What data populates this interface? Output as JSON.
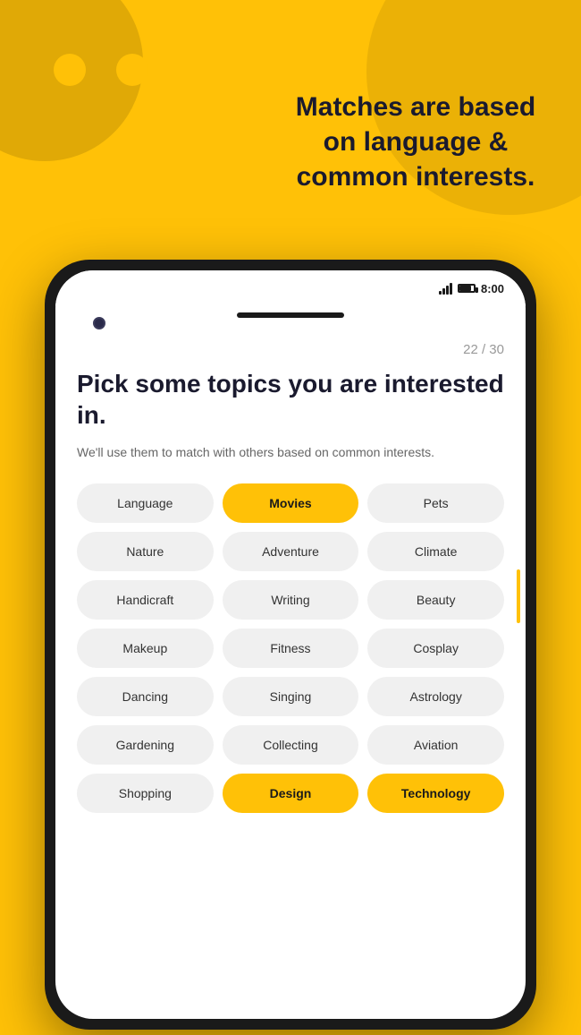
{
  "background": {
    "color": "#FFC107"
  },
  "header": {
    "text": "Matches are based on language & common interests."
  },
  "status_bar": {
    "time": "8:00"
  },
  "phone_screen": {
    "progress": "22 / 30",
    "title": "Pick some topics you are interested in.",
    "subtitle": "We'll use them to match with others based on common interests.",
    "topics": [
      {
        "label": "Language",
        "selected": false
      },
      {
        "label": "Movies",
        "selected": true
      },
      {
        "label": "Pets",
        "selected": false
      },
      {
        "label": "Nature",
        "selected": false
      },
      {
        "label": "Adventure",
        "selected": false
      },
      {
        "label": "Climate",
        "selected": false
      },
      {
        "label": "Handicraft",
        "selected": false
      },
      {
        "label": "Writing",
        "selected": false
      },
      {
        "label": "Beauty",
        "selected": false
      },
      {
        "label": "Makeup",
        "selected": false
      },
      {
        "label": "Fitness",
        "selected": false
      },
      {
        "label": "Cosplay",
        "selected": false
      },
      {
        "label": "Dancing",
        "selected": false
      },
      {
        "label": "Singing",
        "selected": false
      },
      {
        "label": "Astrology",
        "selected": false
      },
      {
        "label": "Gardening",
        "selected": false
      },
      {
        "label": "Collecting",
        "selected": false
      },
      {
        "label": "Aviation",
        "selected": false
      },
      {
        "label": "Shopping",
        "selected": false
      },
      {
        "label": "Design",
        "selected": true
      },
      {
        "label": "Technology",
        "selected": true
      }
    ]
  }
}
